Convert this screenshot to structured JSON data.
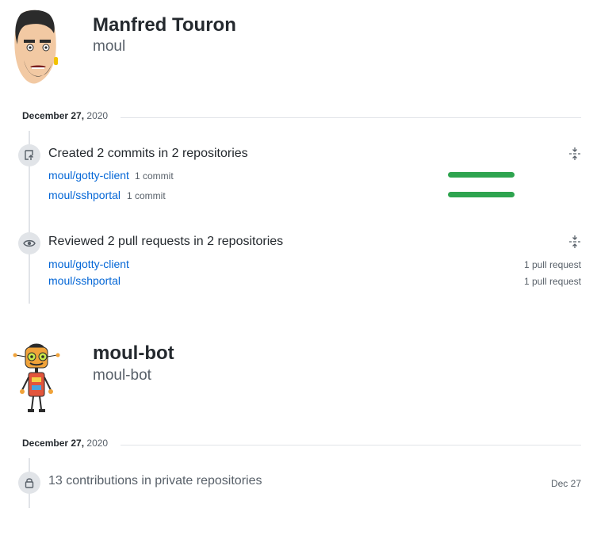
{
  "users": [
    {
      "name": "Manfred Touron",
      "login": "moul",
      "date": {
        "day": "December 27,",
        "year": "2020"
      },
      "activities": [
        {
          "title": "Created 2 commits in 2 repositories",
          "icon": "repo-push-icon",
          "repos": [
            {
              "name": "moul/gotty-client",
              "count": "1 commit",
              "share": 1.0
            },
            {
              "name": "moul/sshportal",
              "count": "1 commit",
              "share": 1.0
            }
          ]
        },
        {
          "title": "Reviewed 2 pull requests in 2 repositories",
          "icon": "eye-icon",
          "repos": [
            {
              "name": "moul/gotty-client",
              "count": "1 pull request"
            },
            {
              "name": "moul/sshportal",
              "count": "1 pull request"
            }
          ]
        }
      ]
    },
    {
      "name": "moul-bot",
      "login": "moul-bot",
      "date": {
        "day": "December 27,",
        "year": "2020"
      },
      "activities": [
        {
          "title": "13 contributions in private repositories",
          "icon": "lock-icon",
          "date": "Dec 27"
        }
      ]
    }
  ],
  "colors": {
    "link": "#0366d6",
    "bar": "#2ea44f",
    "muted": "#586069",
    "line": "#e1e4e8"
  }
}
